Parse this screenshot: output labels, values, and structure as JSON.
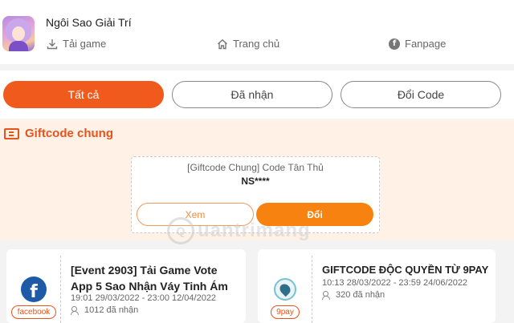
{
  "header": {
    "app_title": "Ngôi Sao Giải Trí",
    "links": {
      "download": "Tải game",
      "home": "Trang chủ",
      "fanpage": "Fanpage"
    }
  },
  "tabs": [
    {
      "label": "Tất cả",
      "active": true
    },
    {
      "label": "Đã nhận",
      "active": false
    },
    {
      "label": "Đổi Code",
      "active": false
    }
  ],
  "section": {
    "title": "Giftcode chung",
    "card": {
      "title": "[Giftcode Chung] Code Tân Thủ",
      "code": "NS****",
      "view_label": "Xem",
      "redeem_label": "Đổi"
    }
  },
  "events": [
    {
      "tag": "facebook",
      "title": "[Event 2903] Tải Game Vote App 5 Sao Nhận Váy Tinh Ám",
      "date": "19:01 29/03/2022 - 23:00 12/04/2022",
      "count": "1012 đã nhận"
    },
    {
      "tag": "9pay",
      "title": "GIFTCODE ĐỘC QUYỀN TỪ 9PAY",
      "date": "10:13 28/03/2022 - 23:59 24/06/2022",
      "count": "320 đã nhận"
    }
  ],
  "watermark": {
    "text": "uantrimang",
    "mark": "Q"
  },
  "colors": {
    "accent": "#f05a1c",
    "accent_text": "#e8531c",
    "section_bg": "#fff1e6",
    "redeem_button": "#f7820f"
  },
  "icons": {
    "download": "download-icon",
    "home": "home-icon",
    "fanpage": "facebook-icon",
    "section": "ticket-icon",
    "count": "people-icon"
  }
}
